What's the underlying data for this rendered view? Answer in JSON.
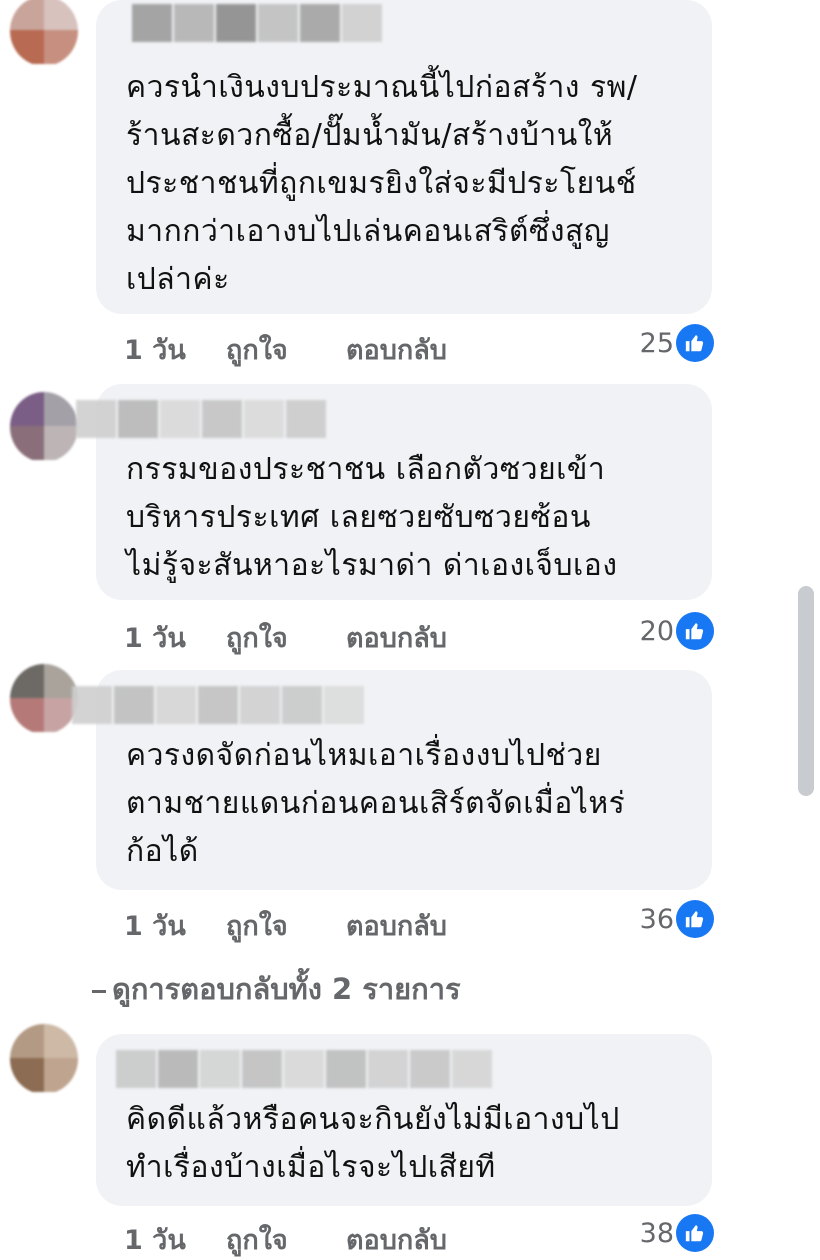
{
  "comments": [
    {
      "text": "ควรนำเงินงบประมาณนี้ไปก่อสร้าง รพ/\nร้านสะดวกซื้อ/ปั๊มน้ำมัน/สร้างบ้านให้\nประชาชนที่ถูกเขมรยิงใส่จะมีประโยนช์\nมากกว่าเอางบไปเล่นคอนเสริต์ซึ่งสูญ\nเปล่าค่ะ",
      "time": "1 วัน",
      "like": "ถูกใจ",
      "reply": "ตอบกลับ",
      "reaction_count": "25"
    },
    {
      "text": "กรรมของประชาชน เลือกตัวซวยเข้า\nบริหารประเทศ เลยซวยซับซวยซ้อน\nไม่รู้จะสันหาอะไรมาด่า ด่าเองเจ็บเอง",
      "time": "1 วัน",
      "like": "ถูกใจ",
      "reply": "ตอบกลับ",
      "reaction_count": "20"
    },
    {
      "text": "ควรงดจัดก่อนไหมเอาเรื่องงบไปช่วย\nตามชายแดนก่อนคอนเสิร์ตจัดเมื่อไหร่\nก้อได้",
      "time": "1 วัน",
      "like": "ถูกใจ",
      "reply": "ตอบกลับ",
      "reaction_count": "36"
    },
    {
      "text": "คิดดีแล้วหรือคนจะกินยังไม่มีเอางบไป\nทำเรื่องบ้างเมื่อไรจะไปเสียที",
      "time": "1 วัน",
      "like": "ถูกใจ",
      "reply": "ตอบกลับ",
      "reaction_count": "38"
    }
  ],
  "view_replies": "ดูการตอบกลับทั้ง 2 รายการ",
  "colors": {
    "bubble": "#f0f2f5",
    "meta_text": "#65676b",
    "like_blue": "#1877f2"
  },
  "icons": {
    "reaction": "like-thumb-icon"
  }
}
